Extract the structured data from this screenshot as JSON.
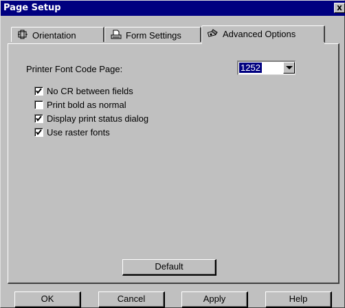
{
  "window": {
    "title": "Page Setup",
    "close_glyph": "x"
  },
  "tabs": [
    {
      "label": "Orientation",
      "icon": "orientation-icon",
      "active": false
    },
    {
      "label": "Form Settings",
      "icon": "form-settings-icon",
      "active": false
    },
    {
      "label": "Advanced Options",
      "icon": "advanced-options-icon",
      "active": true
    }
  ],
  "advanced": {
    "codepage_label": "Printer Font Code Page:",
    "codepage_value": "1252",
    "checkboxes": [
      {
        "label": "No CR between fields",
        "checked": true
      },
      {
        "label": "Print bold as normal",
        "checked": false
      },
      {
        "label": "Display print status dialog",
        "checked": true
      },
      {
        "label": "Use raster fonts",
        "checked": true
      }
    ],
    "default_button": "Default"
  },
  "buttons": {
    "ok": "OK",
    "cancel": "Cancel",
    "apply": "Apply",
    "help": "Help"
  },
  "colors": {
    "titlebar": "#000080",
    "face": "#c0c0c0",
    "selection": "#000080"
  }
}
